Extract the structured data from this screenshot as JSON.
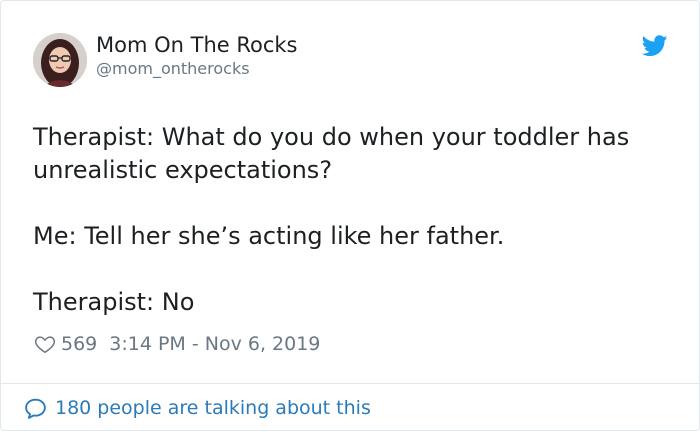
{
  "tweet": {
    "author": {
      "name": "Mom On The Rocks",
      "handle": "@mom_ontherocks"
    },
    "body": [
      "Therapist: What do you do when your toddler has unrealistic expectations?",
      "Me: Tell her she’s acting like her father.",
      "Therapist: No"
    ],
    "likes": "569",
    "timestamp": "3:14 PM - Nov 6, 2019",
    "conversation": "180 people are talking about this"
  },
  "icons": {
    "logo": "twitter-bird-icon",
    "like": "heart-icon",
    "conversation": "speech-bubble-icon"
  },
  "colors": {
    "brand": "#1da1f2",
    "link": "#2b7bb9",
    "text": "#1c2022",
    "muted": "#697882",
    "border": "#e1e8ed"
  }
}
